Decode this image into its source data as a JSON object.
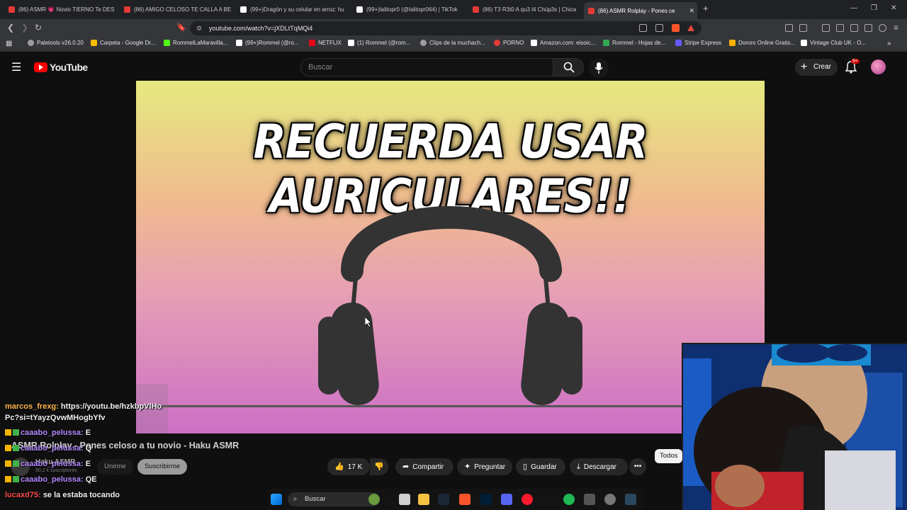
{
  "browser": {
    "tabs": [
      {
        "title": "(86) ASMR 💗 Novio TIERNO Te DES",
        "color": "#e53935"
      },
      {
        "title": "(86) AMIGO CELOSO TE CALLA A BE",
        "color": "#e53935"
      },
      {
        "title": "(99+)Dragón y su celular en arroz: hu",
        "color": "#ffffff"
      },
      {
        "title": "(99+)lalitopr0 (@lalitopr064) | TikTok",
        "color": "#ffffff"
      },
      {
        "title": "(86) T3 R3t0 A qu3 l4 Chúp3s | Chica",
        "color": "#e53935"
      },
      {
        "title": "(86) ASMR Rolplay - Pones ce",
        "color": "#e53935"
      }
    ],
    "new_tab": "+",
    "url": "youtube.com/watch?v=jXDLtTqMQi4",
    "bookmarks": [
      {
        "label": "Paletools v26.0.20",
        "color": "#9e9e9e"
      },
      {
        "label": "Carpeta - Google Dr...",
        "color": "#fbbc04"
      },
      {
        "label": "RommelLaMaravilla...",
        "color": "#53fc18"
      },
      {
        "label": "(99+)Rommel (@ro...",
        "color": "#ffffff"
      },
      {
        "label": "NETFLIX",
        "color": "#e50914"
      },
      {
        "label": "(1) Rommel (@rom...",
        "color": "#ffffff"
      },
      {
        "label": "Clips de la muchach...",
        "color": "#9e9e9e"
      },
      {
        "label": "PORNO",
        "color": "#e53935"
      },
      {
        "label": "Amazon.com: eisoic...",
        "color": "#ffffff"
      },
      {
        "label": "Rommel - Hojas de...",
        "color": "#34a853"
      },
      {
        "label": "Stripe Express",
        "color": "#635bff"
      },
      {
        "label": "Dororo Online Gratis...",
        "color": "#ffb300"
      },
      {
        "label": "Vintage Club UK - O...",
        "color": "#ffffff"
      }
    ]
  },
  "youtube": {
    "logo": "YouTube",
    "search_placeholder": "Buscar",
    "create_label": "Crear",
    "notifications": "9+",
    "video_overlay_text": "RECUERDA USAR AURICULARES!!",
    "video_title": "ASMR Rolplay - Pones celoso a tu novio - Haku ASMR",
    "channel": "Haku ASMR",
    "subscribers": "90,2 k suscriptores",
    "join_label": "Unirme",
    "subscribe_label": "Suscribirme",
    "like_count": "17 K",
    "share_label": "Compartir",
    "ask_label": "Preguntar",
    "save_label": "Guardar",
    "download_label": "Descargar",
    "filter_chip": "Todos"
  },
  "chat": [
    {
      "user": "marcos_frexg:",
      "message": "https://youtu.be/hzkbpVlHoPc?si=tYayzQvwMHogbYfv",
      "user_color": "#ffb74d",
      "badges": false
    },
    {
      "user": "caaabo_pelussa:",
      "message": "E",
      "user_color": "#b388ff",
      "badges": true
    },
    {
      "user": "caaabo_pelussa:",
      "message": "Q",
      "user_color": "#b388ff",
      "badges": true
    },
    {
      "user": "caaabo_pelussa:",
      "message": "E",
      "user_color": "#b388ff",
      "badges": true
    },
    {
      "user": "caaabo_pelussa:",
      "message": "QE",
      "user_color": "#b388ff",
      "badges": true
    },
    {
      "user": "lucaxd75:",
      "message": "se la estaba tocando",
      "user_color": "#ff4d4d",
      "badges": false
    }
  ],
  "taskbar": {
    "search_label": "Buscar",
    "icons": [
      "start-icon",
      "file-explorer-icon",
      "task-view-icon",
      "folder-icon",
      "steam-icon",
      "brave-icon",
      "photoshop-icon",
      "discord-icon",
      "opera-icon",
      "spotify-icon",
      "valorant-icon",
      "chrome-icon",
      "steam2-icon"
    ]
  }
}
